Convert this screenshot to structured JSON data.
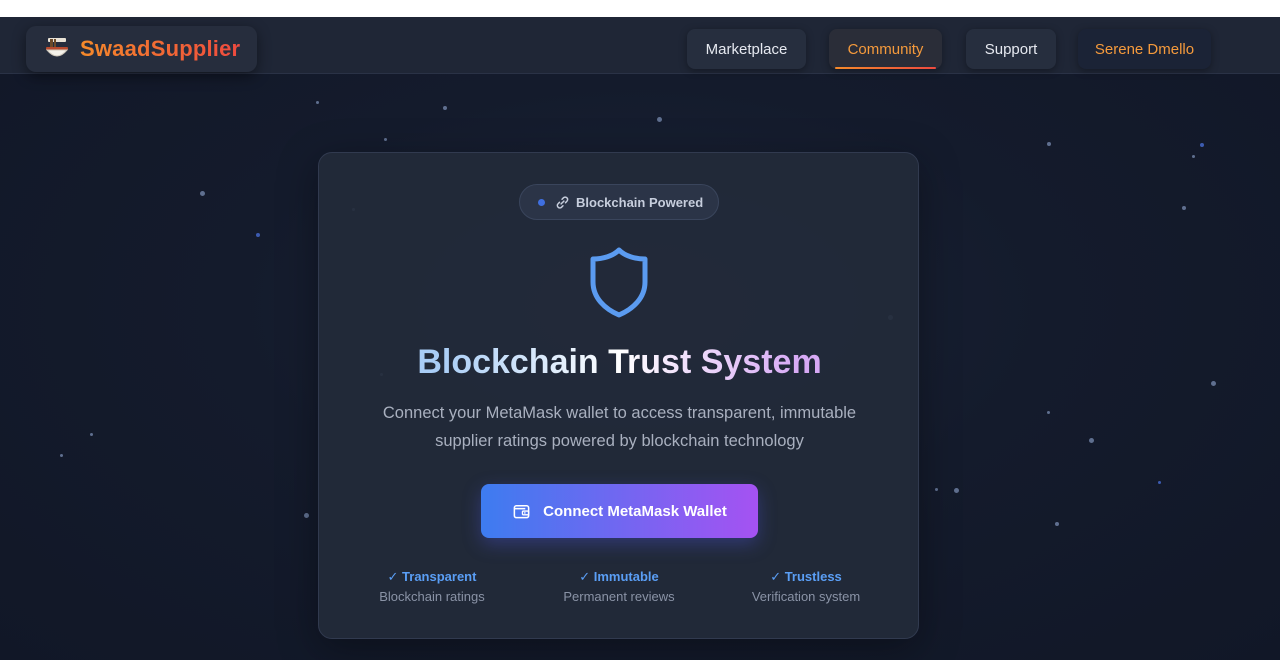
{
  "header": {
    "brand_name": "SwaadSupplier",
    "brand_icon": "noodle-bowl-icon",
    "nav": {
      "marketplace": "Marketplace",
      "community": "Community",
      "support": "Support",
      "user": "Serene Dmello"
    },
    "active_nav": "Community"
  },
  "card": {
    "badge_label": "Blockchain Powered",
    "badge_icon": "link-icon",
    "hero_icon": "shield-icon",
    "title": "Blockchain Trust System",
    "subtitle": "Connect your MetaMask wallet to access transparent, immutable supplier ratings powered by blockchain technology",
    "cta_label": "Connect MetaMask Wallet",
    "cta_icon": "wallet-icon",
    "features": [
      {
        "title": "✓ Transparent",
        "subtitle": "Blockchain ratings"
      },
      {
        "title": "✓ Immutable",
        "subtitle": "Permanent reviews"
      },
      {
        "title": "✓ Trustless",
        "subtitle": "Verification system"
      }
    ]
  },
  "colors": {
    "accent_orange": "#f58a2a",
    "accent_red": "#ee4a3f",
    "cta_start": "#3d7cf0",
    "cta_end": "#a552f2",
    "feature_blue": "#5a9ef5",
    "background": "#131a2b"
  }
}
